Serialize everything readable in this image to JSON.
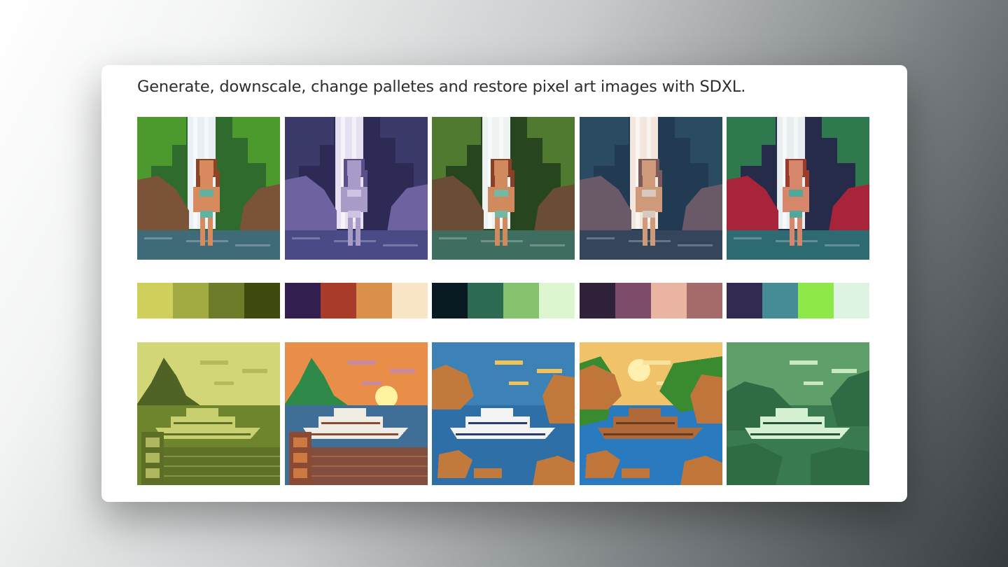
{
  "caption": "Generate, downscale, change palletes and restore pixel art images with SDXL.",
  "row1": [
    {
      "name": "waterfall-original",
      "sky": "#2f6b2c",
      "foliage": "#4c9a2e",
      "water": "#e8f0f6",
      "rocks": "#7a5338",
      "pool": "#3f6a78",
      "skin": "#d68a5d",
      "hair": "#8a4526",
      "suit": "#5fb3a0"
    },
    {
      "name": "waterfall-purple",
      "sky": "#2d2b55",
      "foliage": "#3b3a6b",
      "water": "#e6e0f0",
      "rocks": "#6e63a0",
      "pool": "#4a4a86",
      "skin": "#a99bc8",
      "hair": "#5a4f8a",
      "suit": "#cdc3e3"
    },
    {
      "name": "waterfall-green",
      "sky": "#27461f",
      "foliage": "#4f7a30",
      "water": "#eef2f2",
      "rocks": "#6b4d35",
      "pool": "#3f6e60",
      "skin": "#d08a5e",
      "hair": "#8b3f24",
      "suit": "#73b8a2"
    },
    {
      "name": "waterfall-slate",
      "sky": "#223a52",
      "foliage": "#2b4b62",
      "water": "#f3e6dc",
      "rocks": "#6a5a68",
      "pool": "#35465c",
      "skin": "#cf9a7a",
      "hair": "#7a5a5a",
      "suit": "#d8c9c0"
    },
    {
      "name": "waterfall-red",
      "sky": "#262b4a",
      "foliage": "#2e7a4e",
      "water": "#e8eef0",
      "rocks": "#a8243a",
      "pool": "#2d6a72",
      "skin": "#d6866a",
      "hair": "#9b3b2e",
      "suit": "#4fa89a"
    }
  ],
  "palettes": [
    {
      "name": "palette-olive",
      "colors": [
        "#cfd05b",
        "#a1ab42",
        "#6c7c28",
        "#3e4a10"
      ]
    },
    {
      "name": "palette-warm",
      "colors": [
        "#321f4f",
        "#a83b2a",
        "#d9904b",
        "#f8e5c6"
      ]
    },
    {
      "name": "palette-mint",
      "colors": [
        "#0a1a22",
        "#2c6a52",
        "#86c26e",
        "#dcf6cf"
      ]
    },
    {
      "name": "palette-rose",
      "colors": [
        "#30213a",
        "#7c4c6a",
        "#e9b4a2",
        "#a56a6a"
      ]
    },
    {
      "name": "palette-neon",
      "colors": [
        "#332a52",
        "#468c94",
        "#8fe84a",
        "#dff3e2"
      ]
    }
  ],
  "row2": [
    {
      "name": "yacht-olive",
      "sky": "#d2d676",
      "cloud": "#b4ba5c",
      "island": "#4f6325",
      "sea": "#6f852d",
      "boat": "#c8cf6e",
      "deck": "#5d6f26",
      "rock": "#55682a",
      "sun": "#e4e6a0"
    },
    {
      "name": "yacht-sunset",
      "sky": "#e88e48",
      "cloud": "#c88aa0",
      "island": "#2f8a4a",
      "sea": "#3f6f96",
      "boat": "#f0ede4",
      "deck": "#8a4a34",
      "rock": "#2f8a4a",
      "sun": "#fff3a0"
    },
    {
      "name": "yacht-bay",
      "sky": "#3d82b6",
      "cloud": "#f2c257",
      "island": "#b66a32",
      "sea": "#2e6fa8",
      "boat": "#f2f3f2",
      "deck": "#2a3c70",
      "rock": "#c27a3c",
      "sun": "#f2c257"
    },
    {
      "name": "yacht-jungle",
      "sky": "#f0c36a",
      "cloud": "#f6e3a0",
      "island": "#3a8a30",
      "sea": "#2a7ac0",
      "boat": "#b06a3a",
      "deck": "#6a3a20",
      "rock": "#c0763a",
      "sun": "#fff0b0"
    },
    {
      "name": "yacht-green",
      "sky": "#5fa06a",
      "cloud": "#c9e8c0",
      "island": "#2f6b45",
      "sea": "#3a7a50",
      "boat": "#d6f0d2",
      "deck": "#24523a",
      "rock": "#4a8a5a",
      "sun": "#c9e8c0"
    }
  ]
}
